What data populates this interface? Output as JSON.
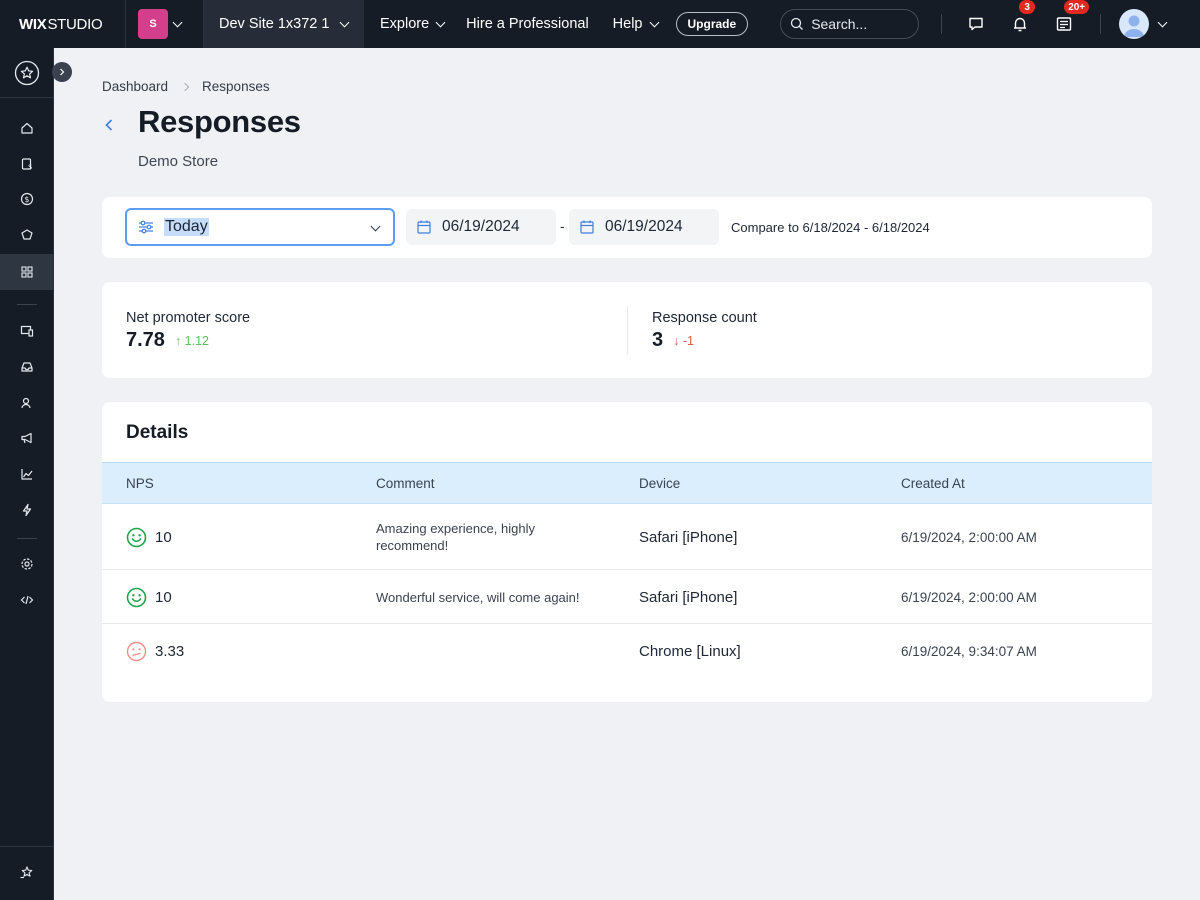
{
  "topbar": {
    "logo_bold": "WIX",
    "logo_text": "STUDIO",
    "site_initial": "S",
    "site_name": "Dev Site 1x372 1",
    "nav": {
      "explore": "Explore",
      "hire": "Hire a Professional",
      "help": "Help"
    },
    "upgrade_label": "Upgrade",
    "search_placeholder": "Search...",
    "notifications_count": "3",
    "updates_count": "20+"
  },
  "breadcrumb": {
    "root": "Dashboard",
    "current": "Responses"
  },
  "page": {
    "title": "Responses",
    "subtitle": "Demo Store"
  },
  "filters": {
    "range_selected": "Today",
    "start_date": "06/19/2024",
    "end_date": "06/19/2024",
    "separator": "-",
    "compare_text": "Compare to 6/18/2024 - 6/18/2024"
  },
  "metrics": {
    "nps": {
      "label": "Net promoter score",
      "value": "7.78",
      "delta": "1.12",
      "trend": "up"
    },
    "responses": {
      "label": "Response count",
      "value": "3",
      "delta": "-1",
      "trend": "down"
    }
  },
  "details": {
    "title": "Details",
    "columns": [
      "NPS",
      "Comment",
      "Device",
      "Created At"
    ],
    "rows": [
      {
        "nps": "10",
        "sentiment": "happy",
        "comment": "Amazing experience, highly recommend!",
        "device": "Safari [iPhone]",
        "created_at": "6/19/2024, 2:00:00 AM"
      },
      {
        "nps": "10",
        "sentiment": "happy",
        "comment": "Wonderful service, will come again!",
        "device": "Safari [iPhone]",
        "created_at": "6/19/2024, 2:00:00 AM"
      },
      {
        "nps": "3.33",
        "sentiment": "unhappy",
        "comment": "",
        "device": "Chrome [Linux]",
        "created_at": "6/19/2024, 9:34:07 AM"
      }
    ]
  },
  "colors": {
    "accent": "#5d9ef5",
    "topbar": "#161c26",
    "positive": "#5cbf5c",
    "negative": "#e05a4e",
    "table_header": "#daeefd"
  }
}
